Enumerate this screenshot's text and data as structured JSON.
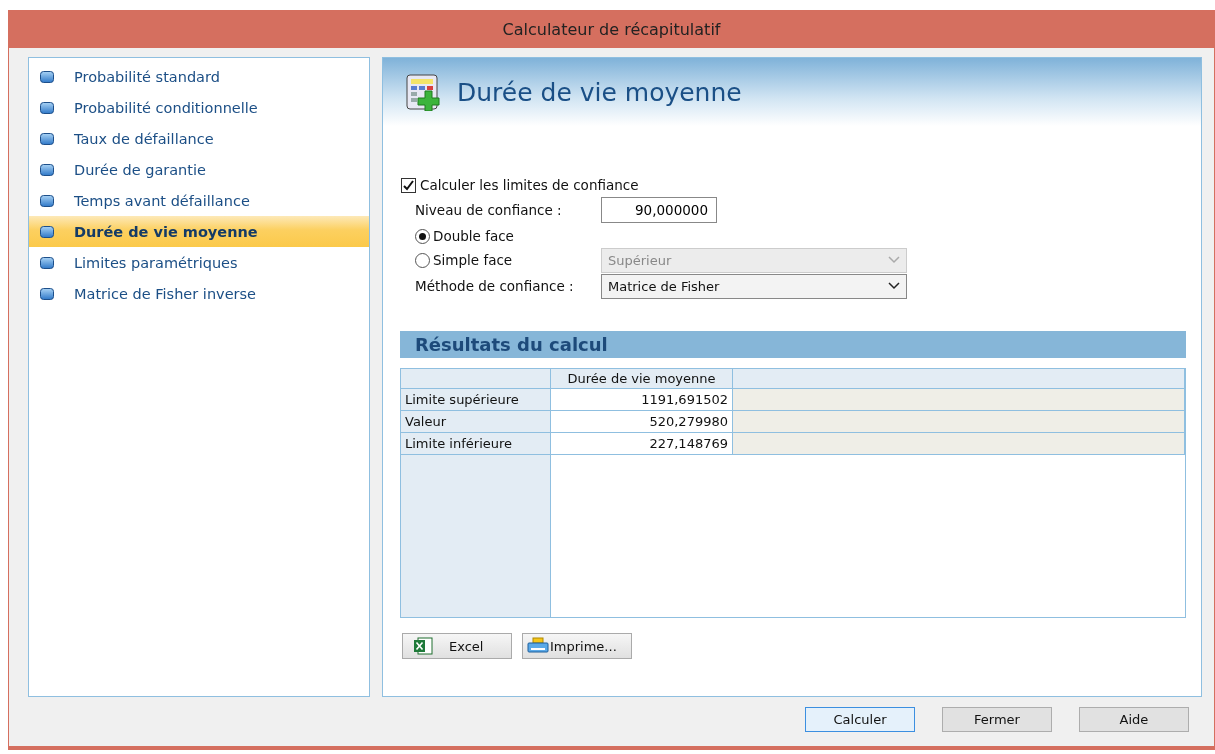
{
  "window": {
    "title": "Calculateur de récapitulatif"
  },
  "sidebar": {
    "items": [
      {
        "label": "Probabilité standard",
        "selected": false
      },
      {
        "label": "Probabilité conditionnelle",
        "selected": false
      },
      {
        "label": "Taux de défaillance",
        "selected": false
      },
      {
        "label": "Durée de garantie",
        "selected": false
      },
      {
        "label": "Temps avant défaillance",
        "selected": false
      },
      {
        "label": "Durée de vie moyenne",
        "selected": true
      },
      {
        "label": "Limites paramétriques",
        "selected": false
      },
      {
        "label": "Matrice de Fisher inverse",
        "selected": false
      }
    ]
  },
  "panel": {
    "title": "Durée de vie moyenne",
    "confidence_checkbox": {
      "label": "Calculer les limites de confiance",
      "checked": true
    },
    "confidence_level": {
      "label": "Niveau de confiance :",
      "value": "90,000000"
    },
    "sides": [
      {
        "label": "Double face",
        "selected": true
      },
      {
        "label": "Simple face",
        "selected": false
      }
    ],
    "side_select": {
      "value": "Supérieur",
      "disabled": true
    },
    "method": {
      "label": "Méthode de confiance :",
      "value": "Matrice de Fisher",
      "disabled": false
    },
    "results": {
      "title": "Résultats du calcul",
      "columns": [
        "Durée de vie moyenne"
      ],
      "rows": [
        {
          "label": "Limite supérieure",
          "value": "1191,691502"
        },
        {
          "label": "Valeur",
          "value": "520,279980"
        },
        {
          "label": "Limite inférieure",
          "value": "227,148769"
        }
      ]
    },
    "export_buttons": [
      {
        "kind": "excel",
        "label": "Excel"
      },
      {
        "kind": "print",
        "label": "Imprime..."
      }
    ]
  },
  "buttons": [
    {
      "label": "Calculer",
      "focused": true
    },
    {
      "label": "Fermer",
      "focused": false
    },
    {
      "label": "Aide",
      "focused": false
    }
  ]
}
